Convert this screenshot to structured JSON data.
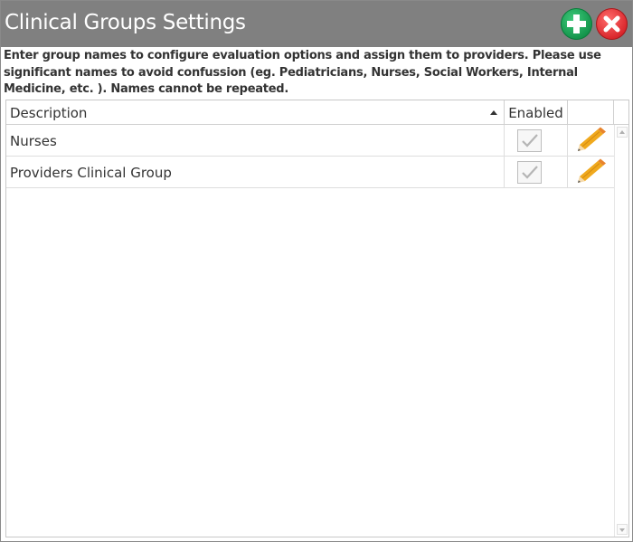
{
  "window": {
    "title": "Clinical Groups Settings",
    "add_icon": "plus-circle-icon",
    "close_icon": "x-circle-icon"
  },
  "instructions": "Enter group names to configure evaluation options and assign them to providers. Please use significant names to avoid confussion (eg. Pediatricians, Nurses, Social Workers, Internal Medicine, etc. ). Names cannot be repeated.",
  "grid": {
    "columns": {
      "description": "Description",
      "enabled": "Enabled",
      "edit": ""
    },
    "sort": {
      "column": "description",
      "direction": "ascending"
    },
    "rows": [
      {
        "description": "Nurses",
        "enabled": true,
        "edit_icon": "pencil-icon"
      },
      {
        "description": "Providers Clinical Group",
        "enabled": true,
        "edit_icon": "pencil-icon"
      }
    ]
  },
  "colors": {
    "titlebar": "#808080",
    "add_button": "#1aa356",
    "close_button": "#e0343a",
    "pencil": "#f0a91d"
  }
}
